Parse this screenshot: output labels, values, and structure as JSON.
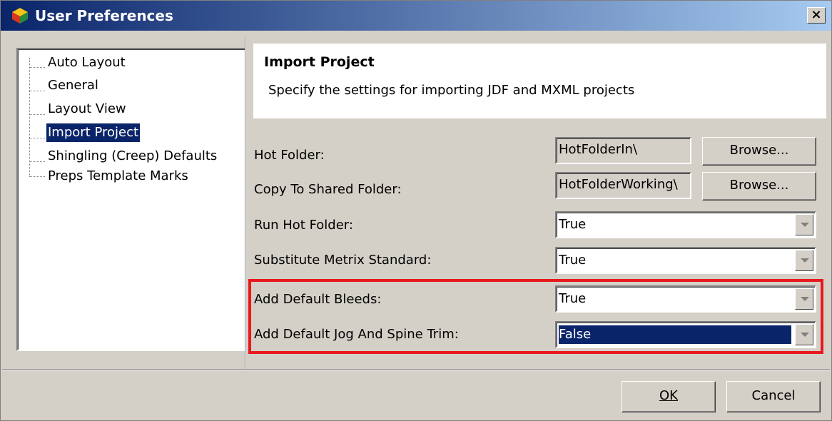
{
  "window": {
    "title": "User Preferences",
    "close_label": "×"
  },
  "tree": {
    "items": [
      {
        "label": "Auto Layout"
      },
      {
        "label": "General"
      },
      {
        "label": "Layout View"
      },
      {
        "label": "Import Project"
      },
      {
        "label": "Shingling (Creep) Defaults"
      },
      {
        "label": "Preps Template Marks"
      }
    ],
    "selected": "Import Project"
  },
  "header": {
    "title": "Import Project",
    "description": "Specify the settings for importing JDF and MXML projects"
  },
  "settings": {
    "hot_folder": {
      "label": "Hot Folder:",
      "value": "HotFolderIn\\",
      "browse_label": "Browse..."
    },
    "copy_to_shared": {
      "label": "Copy To Shared Folder:",
      "value": "HotFolderWorking\\",
      "browse_label": "Browse..."
    },
    "run_hot_folder": {
      "label": "Run Hot Folder:",
      "value": "True"
    },
    "substitute_metrix": {
      "label": "Substitute Metrix Standard:",
      "value": "True"
    },
    "add_default_bleeds": {
      "label": "Add Default Bleeds:",
      "value": "True"
    },
    "add_default_jog": {
      "label": "Add Default Jog And Spine Trim:",
      "value": "False"
    }
  },
  "footer": {
    "ok_label": "OK",
    "cancel_label": "Cancel"
  },
  "colors": {
    "titlebar": "#0a246a",
    "selection": "#0a246a",
    "highlight_box": "#e8191d",
    "face": "#d4d0c8"
  }
}
